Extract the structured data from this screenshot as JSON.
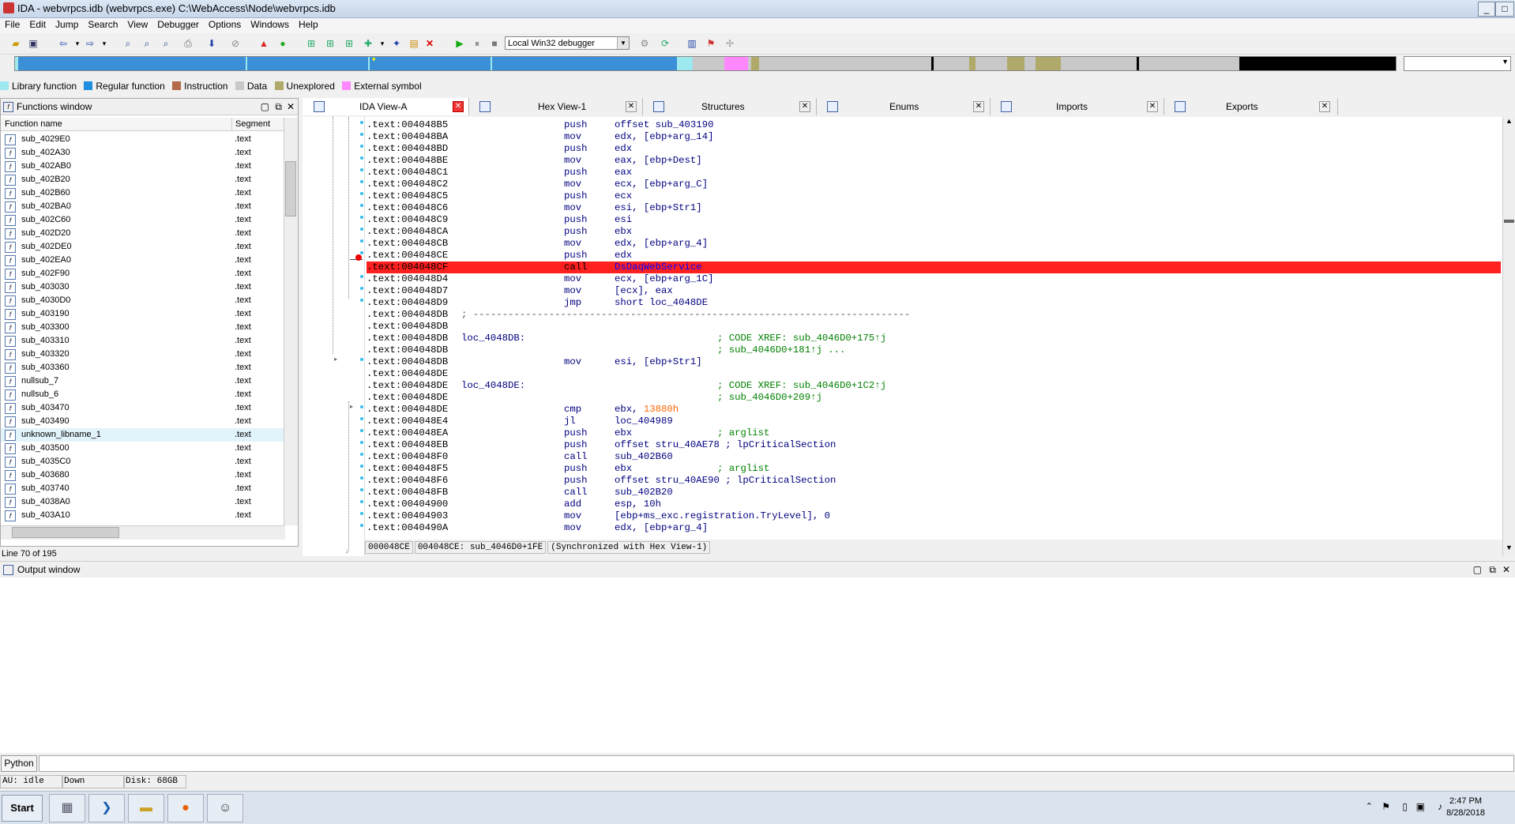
{
  "window": {
    "title": "IDA - webvrpcs.idb (webvrpcs.exe) C:\\WebAccess\\Node\\webvrpcs.idb",
    "controls": [
      "_",
      "□",
      "✕"
    ]
  },
  "menu": [
    "File",
    "Edit",
    "Jump",
    "Search",
    "View",
    "Debugger",
    "Options",
    "Windows",
    "Help"
  ],
  "toolbar": {
    "debugger_select": "Local Win32 debugger"
  },
  "legend": [
    {
      "label": "Library function",
      "color": "#9ee8f0"
    },
    {
      "label": "Regular function",
      "color": "#1d8ee0"
    },
    {
      "label": "Instruction",
      "color": "#b46a4a"
    },
    {
      "label": "Data",
      "color": "#c8c8c8"
    },
    {
      "label": "Unexplored",
      "color": "#b0aa6a"
    },
    {
      "label": "External symbol",
      "color": "#ff88ff"
    }
  ],
  "functions_window": {
    "title": "Functions window",
    "col_name": "Function name",
    "col_segment": "Segment",
    "status": "Line 70 of 195",
    "rows": [
      {
        "name": "sub_4029E0",
        "seg": ".text"
      },
      {
        "name": "sub_402A30",
        "seg": ".text"
      },
      {
        "name": "sub_402AB0",
        "seg": ".text"
      },
      {
        "name": "sub_402B20",
        "seg": ".text"
      },
      {
        "name": "sub_402B60",
        "seg": ".text"
      },
      {
        "name": "sub_402BA0",
        "seg": ".text"
      },
      {
        "name": "sub_402C60",
        "seg": ".text"
      },
      {
        "name": "sub_402D20",
        "seg": ".text"
      },
      {
        "name": "sub_402DE0",
        "seg": ".text"
      },
      {
        "name": "sub_402EA0",
        "seg": ".text"
      },
      {
        "name": "sub_402F90",
        "seg": ".text"
      },
      {
        "name": "sub_403030",
        "seg": ".text"
      },
      {
        "name": "sub_4030D0",
        "seg": ".text"
      },
      {
        "name": "sub_403190",
        "seg": ".text"
      },
      {
        "name": "sub_403300",
        "seg": ".text"
      },
      {
        "name": "sub_403310",
        "seg": ".text"
      },
      {
        "name": "sub_403320",
        "seg": ".text"
      },
      {
        "name": "sub_403360",
        "seg": ".text"
      },
      {
        "name": "nullsub_7",
        "seg": ".text"
      },
      {
        "name": "nullsub_6",
        "seg": ".text"
      },
      {
        "name": "sub_403470",
        "seg": ".text"
      },
      {
        "name": "sub_403490",
        "seg": ".text"
      },
      {
        "name": "unknown_libname_1",
        "seg": ".text"
      },
      {
        "name": "sub_403500",
        "seg": ".text"
      },
      {
        "name": "sub_4035C0",
        "seg": ".text"
      },
      {
        "name": "sub_403680",
        "seg": ".text"
      },
      {
        "name": "sub_403740",
        "seg": ".text"
      },
      {
        "name": "sub_4038A0",
        "seg": ".text"
      },
      {
        "name": "sub_403A10",
        "seg": ".text"
      }
    ]
  },
  "tabs": [
    {
      "label": "IDA View-A",
      "active": true
    },
    {
      "label": "Hex View-1",
      "active": false
    },
    {
      "label": "Structures",
      "active": false
    },
    {
      "label": "Enums",
      "active": false
    },
    {
      "label": "Imports",
      "active": false
    },
    {
      "label": "Exports",
      "active": false
    }
  ],
  "code_lines": [
    {
      "addr": ".text:004048B5",
      "mn": "push",
      "op": "offset sub_403190",
      "cm": ""
    },
    {
      "addr": ".text:004048BA",
      "mn": "mov",
      "op": "edx, [ebp+arg_14]",
      "cm": ""
    },
    {
      "addr": ".text:004048BD",
      "mn": "push",
      "op": "edx",
      "cm": ""
    },
    {
      "addr": ".text:004048BE",
      "mn": "mov",
      "op": "eax, [ebp+Dest]",
      "cm": ""
    },
    {
      "addr": ".text:004048C1",
      "mn": "push",
      "op": "eax",
      "cm": ""
    },
    {
      "addr": ".text:004048C2",
      "mn": "mov",
      "op": "ecx, [ebp+arg_C]",
      "cm": ""
    },
    {
      "addr": ".text:004048C5",
      "mn": "push",
      "op": "ecx",
      "cm": ""
    },
    {
      "addr": ".text:004048C6",
      "mn": "mov",
      "op": "esi, [ebp+Str1]",
      "cm": ""
    },
    {
      "addr": ".text:004048C9",
      "mn": "push",
      "op": "esi",
      "cm": ""
    },
    {
      "addr": ".text:004048CA",
      "mn": "push",
      "op": "ebx",
      "cm": ""
    },
    {
      "addr": ".text:004048CB",
      "mn": "mov",
      "op": "edx, [ebp+arg_4]",
      "cm": ""
    },
    {
      "addr": ".text:004048CE",
      "mn": "push",
      "op": "edx",
      "cm": ""
    },
    {
      "addr": ".text:004048CF",
      "mn": "call",
      "op": "DsDaqWebService",
      "cm": "",
      "breakpoint": true
    },
    {
      "addr": ".text:004048D4",
      "mn": "mov",
      "op": "ecx, [ebp+arg_1C]",
      "cm": ""
    },
    {
      "addr": ".text:004048D7",
      "mn": "mov",
      "op": "[ecx], eax",
      "cm": ""
    },
    {
      "addr": ".text:004048D9",
      "mn": "jmp",
      "op": "short loc_4048DE",
      "cm": ""
    },
    {
      "addr": ".text:004048DB",
      "sep": "; ---------------------------------------------------------------------------"
    },
    {
      "addr": ".text:004048DB",
      "mn": "",
      "op": "",
      "cm": ""
    },
    {
      "addr": ".text:004048DB",
      "label": "loc_4048DB:",
      "cm": "; CODE XREF: sub_4046D0+175↑j"
    },
    {
      "addr": ".text:004048DB",
      "mn": "",
      "op": "",
      "cm": "; sub_4046D0+181↑j ..."
    },
    {
      "addr": ".text:004048DB",
      "mn": "mov",
      "op": "esi, [ebp+Str1]",
      "cm": ""
    },
    {
      "addr": ".text:004048DE",
      "mn": "",
      "op": "",
      "cm": ""
    },
    {
      "addr": ".text:004048DE",
      "label": "loc_4048DE:",
      "cm": "; CODE XREF: sub_4046D0+1C2↑j"
    },
    {
      "addr": ".text:004048DE",
      "mn": "",
      "op": "",
      "cm": "; sub_4046D0+209↑j"
    },
    {
      "addr": ".text:004048DE",
      "mn": "cmp",
      "op": "ebx, ",
      "num": "13880h",
      "cm": ""
    },
    {
      "addr": ".text:004048E4",
      "mn": "jl",
      "op": "loc_404989",
      "cm": ""
    },
    {
      "addr": ".text:004048EA",
      "mn": "push",
      "op": "ebx",
      "cm": "; arglist"
    },
    {
      "addr": ".text:004048EB",
      "mn": "push",
      "op": "offset stru_40AE78 ; lpCriticalSection",
      "cm": ""
    },
    {
      "addr": ".text:004048F0",
      "mn": "call",
      "op": "sub_402B60",
      "cm": ""
    },
    {
      "addr": ".text:004048F5",
      "mn": "push",
      "op": "ebx",
      "cm": "; arglist"
    },
    {
      "addr": ".text:004048F6",
      "mn": "push",
      "op": "offset stru_40AE90 ; lpCriticalSection",
      "cm": ""
    },
    {
      "addr": ".text:004048FB",
      "mn": "call",
      "op": "sub_402B20",
      "cm": ""
    },
    {
      "addr": ".text:00404900",
      "mn": "add",
      "op": "esp, 10h",
      "cm": ""
    },
    {
      "addr": ".text:00404903",
      "mn": "mov",
      "op": "[ebp+ms_exc.registration.TryLevel], 0",
      "cm": ""
    },
    {
      "addr": ".text:0040490A",
      "mn": "mov",
      "op": "edx, [ebp+arg_4]",
      "cm": ""
    }
  ],
  "code_status": {
    "offset": "000048CE",
    "location": "004048CE: sub_4046D0+1FE",
    "sync": "(Synchronized with Hex View-1)"
  },
  "output_window": {
    "title": "Output window"
  },
  "python_button": "Python",
  "statusbar": {
    "au": "AU:  idle",
    "dir": "Down",
    "disk": "Disk: 68GB"
  },
  "taskbar": {
    "start": "Start",
    "time": "2:47 PM",
    "date": "8/28/2018"
  }
}
